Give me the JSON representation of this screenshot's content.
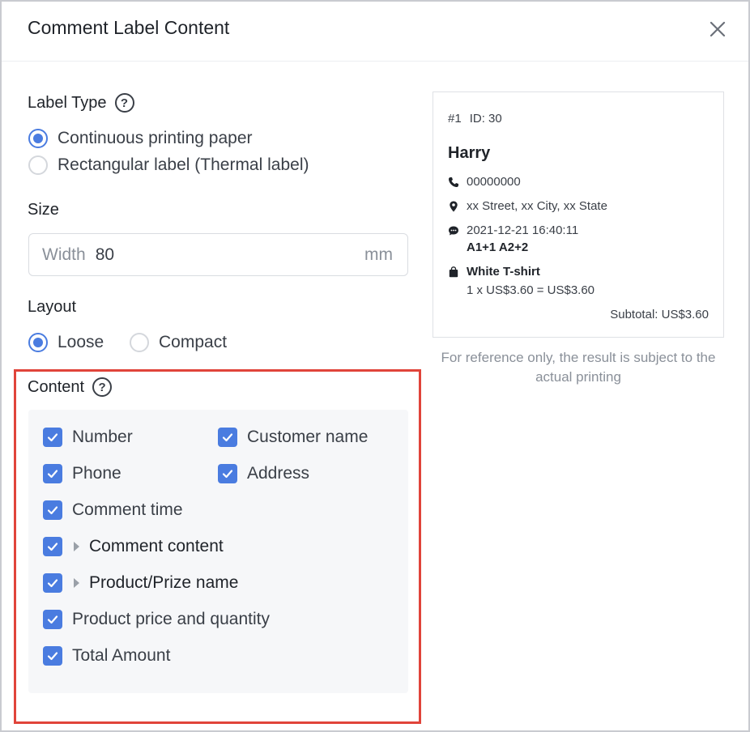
{
  "dialog": {
    "title": "Comment Label Content"
  },
  "label_type": {
    "heading": "Label Type",
    "help": "?",
    "options": [
      {
        "label": "Continuous printing paper",
        "checked": true
      },
      {
        "label": "Rectangular label (Thermal label)",
        "checked": false
      }
    ]
  },
  "size": {
    "heading": "Size",
    "prefix": "Width",
    "value": "80",
    "unit": "mm"
  },
  "layout": {
    "heading": "Layout",
    "options": [
      {
        "label": "Loose",
        "checked": true
      },
      {
        "label": "Compact",
        "checked": false
      }
    ]
  },
  "content": {
    "heading": "Content",
    "help": "?",
    "items": [
      {
        "label": "Number",
        "checked": true
      },
      {
        "label": "Customer name",
        "checked": true
      },
      {
        "label": "Phone",
        "checked": true
      },
      {
        "label": "Address",
        "checked": true
      },
      {
        "label": "Comment time",
        "checked": true
      },
      {
        "label": "Comment content",
        "checked": true,
        "expandable": true
      },
      {
        "label": "Product/Prize name",
        "checked": true,
        "expandable": true
      },
      {
        "label": "Product price and quantity",
        "checked": true
      },
      {
        "label": "Total Amount",
        "checked": true
      }
    ]
  },
  "preview": {
    "number": "#1",
    "id": "ID: 30",
    "name": "Harry",
    "phone": "00000000",
    "address": "xx Street, xx City, xx State",
    "comment_time": "2021-12-21 16:40:11",
    "comment_content": "A1+1 A2+2",
    "product": "White T-shirt",
    "price_qty": "1 x US$3.60 = US$3.60",
    "subtotal": "Subtotal: US$3.60",
    "note": "For reference only, the result is subject to the actual printing"
  },
  "colors": {
    "accent": "#4a7ce0",
    "highlight": "#e0443a"
  },
  "icons": {
    "close": "close-icon",
    "help": "help-circle-icon",
    "phone": "phone-icon",
    "location": "location-pin-icon",
    "comment": "chat-bubble-icon",
    "bag": "shopping-bag-icon",
    "check": "checkmark-icon",
    "caret": "caret-right-icon"
  }
}
